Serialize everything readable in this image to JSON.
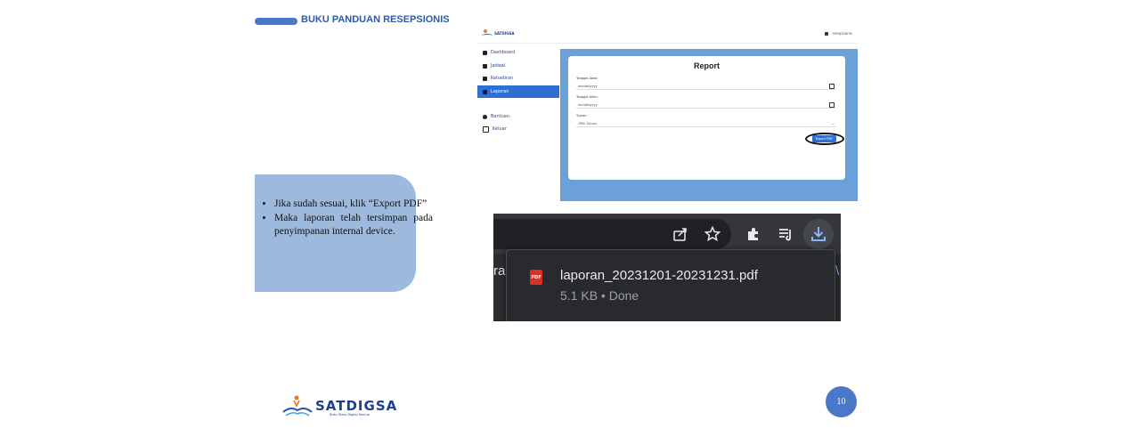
{
  "header": {
    "title": "BUKU PANDUAN RESEPSIONIS"
  },
  "app_screenshot": {
    "logo_text": "SATDIGSA",
    "user_label": "resepsionis",
    "nav": [
      {
        "label": "Dashboard",
        "icon": "dashboard-icon"
      },
      {
        "label": "Jadwal",
        "icon": "calendar-icon"
      },
      {
        "label": "Kehadiran",
        "icon": "person-icon"
      },
      {
        "label": "Laporan",
        "icon": "report-icon",
        "active": true
      },
      {
        "label": "Bantuan",
        "icon": "help-icon"
      },
      {
        "label": "Keluar",
        "icon": "logout-icon"
      }
    ],
    "card_title": "Report",
    "fields": [
      {
        "label": "Tanggal Awal:",
        "value": "mm/dd/yyyy"
      },
      {
        "label": "Tanggal Akhir:",
        "value": "mm/dd/yyyy"
      },
      {
        "label": "Tujuan :",
        "value": "-Pilih Tujuan-"
      }
    ],
    "export_label": "Export PDF"
  },
  "download_screenshot": {
    "left_fragment": "rac",
    "right_fragment": "\\",
    "file_name": "laporan_20231201-20231231.pdf",
    "file_meta": "5.1 KB • Done",
    "file_type_badge": "PDF"
  },
  "note": {
    "items": [
      "Jika sudah sesuai, klik “Export PDF”",
      "Maka laporan telah tersimpan pada penyimpanan internal device."
    ]
  },
  "footer": {
    "logo_name": "SATDIGSA",
    "logo_tagline": "Buku Tamu Digital Semua",
    "page_number": "10"
  },
  "colors": {
    "accent": "#4a78c8",
    "note_box": "#9db9de",
    "app_blue": "#2e6fd3"
  }
}
